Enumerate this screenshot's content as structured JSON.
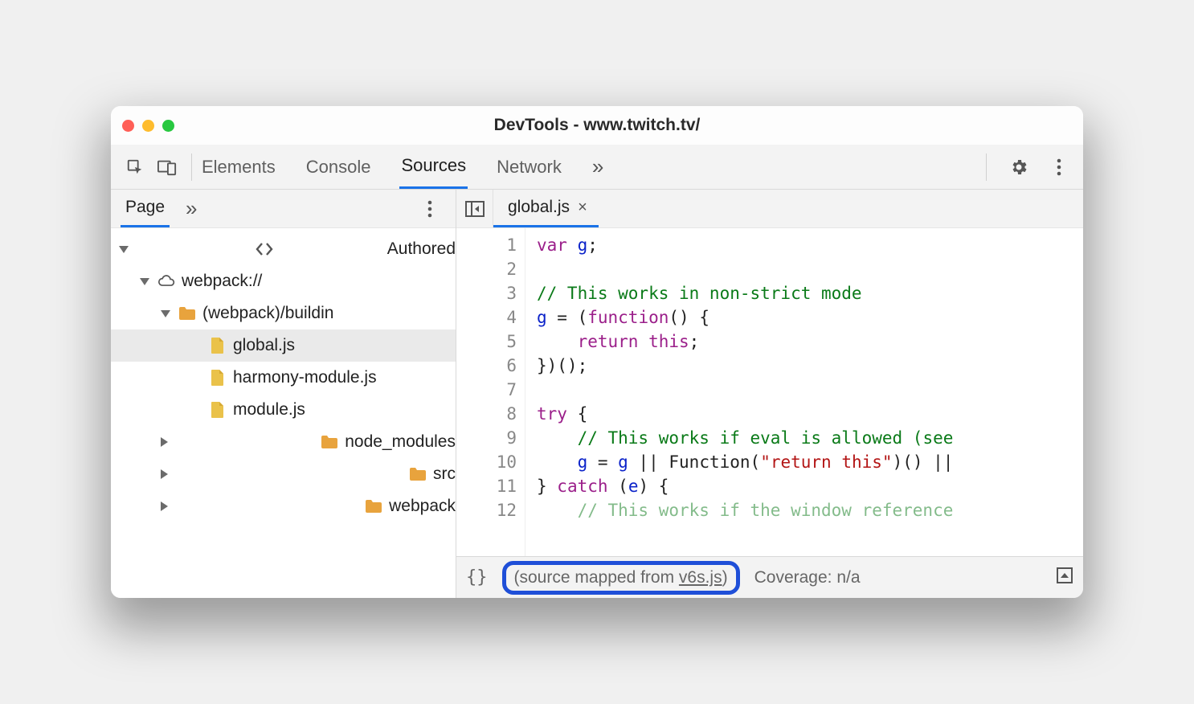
{
  "window": {
    "title": "DevTools - www.twitch.tv/"
  },
  "tabs": {
    "items": [
      "Elements",
      "Console",
      "Sources",
      "Network"
    ],
    "activeIndex": 2,
    "moreGlyph": "»"
  },
  "leftPanel": {
    "tabs": {
      "active": "Page",
      "moreGlyph": "»"
    },
    "tree": {
      "authored": "Authored",
      "webpack": "webpack://",
      "buildin": "(webpack)/buildin",
      "files_buildin": [
        "global.js",
        "harmony-module.js",
        "module.js"
      ],
      "folders_more": [
        "node_modules",
        "src",
        "webpack"
      ],
      "selectedFileIndex": 0
    }
  },
  "editor": {
    "tab": {
      "name": "global.js",
      "closeGlyph": "×"
    },
    "lineCount": 12,
    "lines": [
      [
        [
          "kw",
          "var"
        ],
        [
          "pn",
          " "
        ],
        [
          "id",
          "g"
        ],
        [
          "pn",
          ";"
        ]
      ],
      [],
      [
        [
          "cm",
          "// This works in non-strict mode"
        ]
      ],
      [
        [
          "id",
          "g"
        ],
        [
          "pn",
          " = ("
        ],
        [
          "kw",
          "function"
        ],
        [
          "pn",
          "() {"
        ]
      ],
      [
        [
          "pn",
          "    "
        ],
        [
          "kw",
          "return"
        ],
        [
          "pn",
          " "
        ],
        [
          "kw",
          "this"
        ],
        [
          "pn",
          ";"
        ]
      ],
      [
        [
          "pn",
          "})();"
        ]
      ],
      [],
      [
        [
          "kw",
          "try"
        ],
        [
          "pn",
          " {"
        ]
      ],
      [
        [
          "pn",
          "    "
        ],
        [
          "cm",
          "// This works if eval is allowed (see"
        ]
      ],
      [
        [
          "pn",
          "    "
        ],
        [
          "id",
          "g"
        ],
        [
          "pn",
          " = "
        ],
        [
          "id",
          "g"
        ],
        [
          "pn",
          " || Function("
        ],
        [
          "str",
          "\"return this\""
        ],
        [
          "pn",
          ")() ||"
        ]
      ],
      [
        [
          "pn",
          "} "
        ],
        [
          "kw",
          "catch"
        ],
        [
          "pn",
          " ("
        ],
        [
          "id",
          "e"
        ],
        [
          "pn",
          ") {"
        ]
      ],
      [
        [
          "partial",
          "    // This works if the window reference"
        ]
      ]
    ]
  },
  "status": {
    "formatGlyph": "{}",
    "mapped_prefix": "(source mapped from ",
    "mapped_link": "v6s.js",
    "mapped_suffix": ")",
    "coverage": "Coverage: n/a"
  },
  "icons": {
    "gear": "gear-icon",
    "kebab": "kebab-icon",
    "inspect": "inspect-icon",
    "devices": "devices-icon",
    "collapse": "collapse-panel-icon",
    "expand": "expand-icon"
  }
}
